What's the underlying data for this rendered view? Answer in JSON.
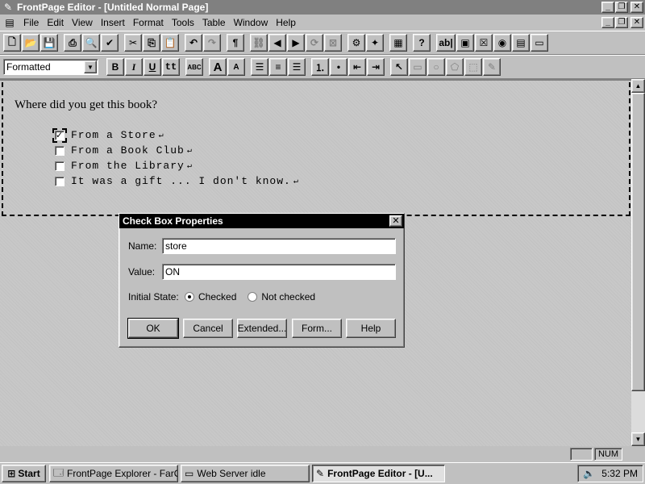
{
  "window": {
    "title": "FrontPage Editor - [Untitled Normal Page]",
    "app_icon": "frontpage-icon",
    "controls": [
      "_",
      "❐",
      "✕"
    ]
  },
  "menubar": {
    "items": [
      {
        "label": "File"
      },
      {
        "label": "Edit"
      },
      {
        "label": "View"
      },
      {
        "label": "Insert"
      },
      {
        "label": "Format"
      },
      {
        "label": "Tools"
      },
      {
        "label": "Table"
      },
      {
        "label": "Window"
      },
      {
        "label": "Help"
      }
    ],
    "controls": [
      "_",
      "❐",
      "✕"
    ]
  },
  "format_toolbar": {
    "style_value": "Formatted",
    "bold": "B",
    "italic": "I",
    "underline": "U",
    "typewriter": "tt",
    "spell": "ABC",
    "grow_font": "A",
    "shrink_font": "A"
  },
  "document": {
    "question": "Where did you get this book?",
    "checkboxes": [
      {
        "label": "From a Store",
        "checked": true
      },
      {
        "label": "From a Book Club",
        "checked": false
      },
      {
        "label": "From the Library",
        "checked": false
      },
      {
        "label": "It was a gift ... I don't know.",
        "checked": false
      }
    ],
    "check_mark": "✓",
    "para_mark": "↵"
  },
  "dialog": {
    "title": "Check Box Properties",
    "close": "✕",
    "name_label": "Name:",
    "name_value": "store",
    "value_label": "Value:",
    "value_value": "ON",
    "initial_state_label": "Initial State:",
    "checked_label": "Checked",
    "not_checked_label": "Not checked",
    "initial_state": "checked",
    "buttons": {
      "ok": "OK",
      "cancel": "Cancel",
      "extended": "Extended...",
      "form": "Form...",
      "help": "Help"
    }
  },
  "statusbar": {
    "num": "NUM"
  },
  "taskbar": {
    "start": "Start",
    "tasks": [
      {
        "label": "FrontPage Explorer - FarO...",
        "active": false
      },
      {
        "label": "Web Server idle",
        "active": false
      },
      {
        "label": "FrontPage Editor - [U...",
        "active": true
      }
    ],
    "clock": "5:32 PM"
  }
}
